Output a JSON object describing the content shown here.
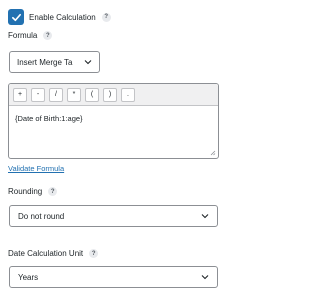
{
  "enable_calc": {
    "label": "Enable Calculation",
    "checked": true,
    "help": "?"
  },
  "formula": {
    "label": "Formula",
    "help": "?",
    "merge_tag_button": "Insert Merge Ta",
    "operators": [
      "+",
      "-",
      "/",
      "*",
      "(",
      ")",
      "."
    ],
    "value": "{Date of Birth:1:age}",
    "validate_link": "Validate Formula"
  },
  "rounding": {
    "label": "Rounding",
    "help": "?",
    "selected": "Do not round"
  },
  "date_unit": {
    "label": "Date Calculation Unit",
    "help": "?",
    "selected": "Years"
  },
  "colors": {
    "accent": "#2271b1",
    "border": "#8c8f94",
    "toolbar_bg": "#f0f0f1"
  },
  "icons": {
    "checkbox": "check-icon",
    "dropdown": "chevron-down-icon",
    "resize": "resize-handle-icon"
  }
}
